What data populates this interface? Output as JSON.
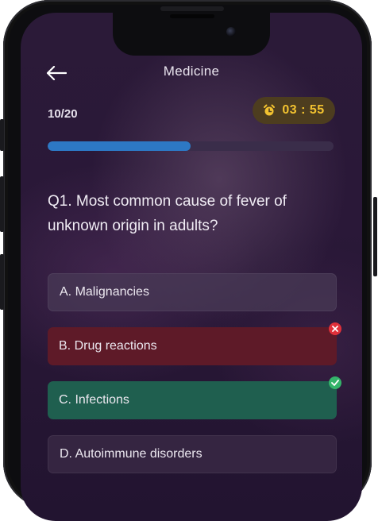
{
  "header": {
    "title": "Medicine",
    "back_icon": "arrow-left-icon"
  },
  "quiz": {
    "counter": "10/20",
    "timer": "03 : 55",
    "timer_icon": "alarm-clock-icon",
    "progress_fraction": 0.5,
    "question": "Q1. Most common cause of fever of unknown origin in adults?"
  },
  "options": [
    {
      "label": "A. Malignancies",
      "state": "default"
    },
    {
      "label": "B.  Drug reactions",
      "state": "wrong",
      "icon": "x-circle-icon"
    },
    {
      "label": "C. Infections",
      "state": "correct",
      "icon": "check-circle-icon"
    },
    {
      "label": "D. Autoimmune disorders",
      "state": "default"
    }
  ],
  "colors": {
    "accent": "#2d78c4",
    "timer_text": "#f2c230",
    "wrong": "#5e1a28",
    "correct": "#1f5f4f"
  }
}
